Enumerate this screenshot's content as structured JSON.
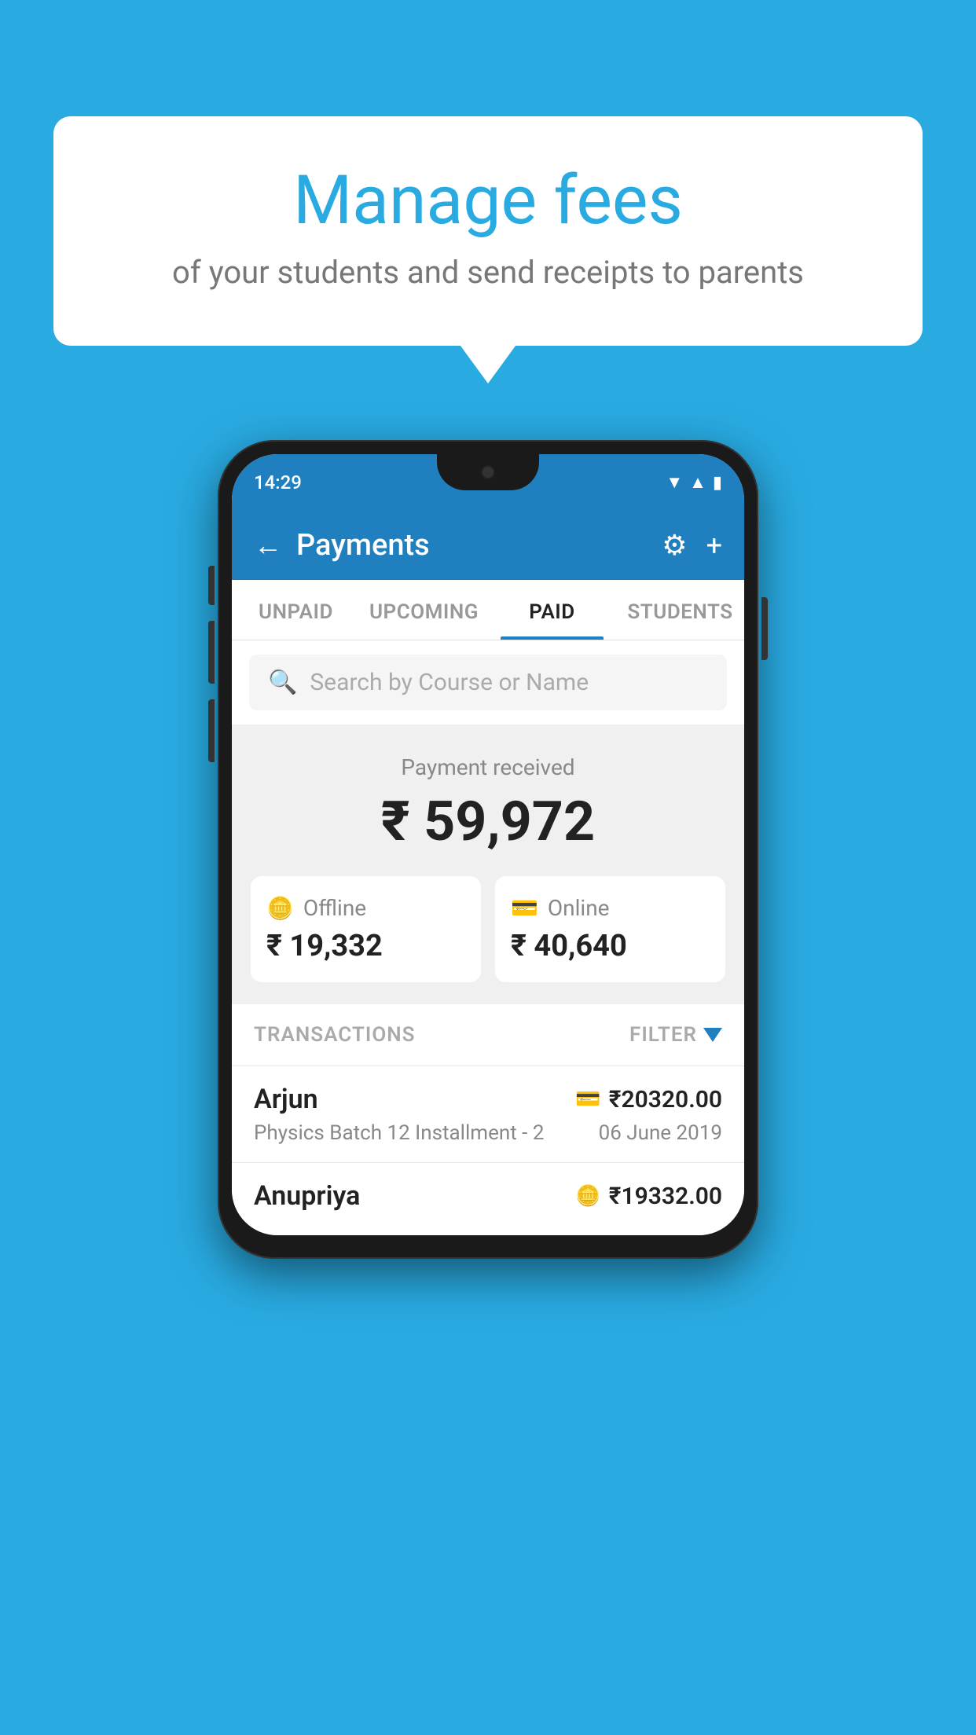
{
  "page": {
    "background_color": "#29abe2"
  },
  "speech_bubble": {
    "title": "Manage fees",
    "subtitle": "of your students and send receipts to parents"
  },
  "phone": {
    "status_bar": {
      "time": "14:29"
    },
    "header": {
      "title": "Payments",
      "back_label": "←",
      "settings_label": "⚙",
      "add_label": "+"
    },
    "tabs": [
      {
        "label": "UNPAID",
        "active": false
      },
      {
        "label": "UPCOMING",
        "active": false
      },
      {
        "label": "PAID",
        "active": true
      },
      {
        "label": "STUDENTS",
        "active": false
      }
    ],
    "search": {
      "placeholder": "Search by Course or Name"
    },
    "payment_summary": {
      "label": "Payment received",
      "total": "₹ 59,972",
      "offline": {
        "label": "Offline",
        "amount": "₹ 19,332"
      },
      "online": {
        "label": "Online",
        "amount": "₹ 40,640"
      }
    },
    "transactions": {
      "header_label": "TRANSACTIONS",
      "filter_label": "FILTER",
      "rows": [
        {
          "name": "Arjun",
          "course": "Physics Batch 12 Installment - 2",
          "amount": "₹20320.00",
          "date": "06 June 2019",
          "payment_icon": "card"
        },
        {
          "name": "Anupriya",
          "course": "",
          "amount": "₹19332.00",
          "date": "",
          "payment_icon": "offline"
        }
      ]
    }
  }
}
